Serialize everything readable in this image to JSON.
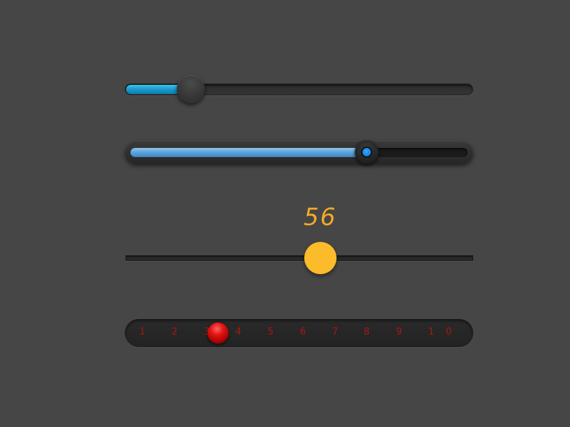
{
  "sliders": {
    "slider_1": {
      "value_fraction": 0.19,
      "fill_color": "#1597cc"
    },
    "slider_2": {
      "value_fraction": 0.7,
      "fill_color": "#5aa2da",
      "knob_center_color": "#0a6ed6"
    },
    "slider_3": {
      "value_label": "56",
      "value_fraction": 0.56,
      "knob_color": "#fbbb2a",
      "label_color": "#f2aa26"
    },
    "slider_4": {
      "tick_labels": [
        "1",
        "2",
        "3",
        "4",
        "5",
        "6",
        "7",
        "8",
        "9",
        "1",
        "0"
      ],
      "selected_position": 3.5,
      "knob_color": "#e01313",
      "label_color": "#b21414"
    }
  }
}
